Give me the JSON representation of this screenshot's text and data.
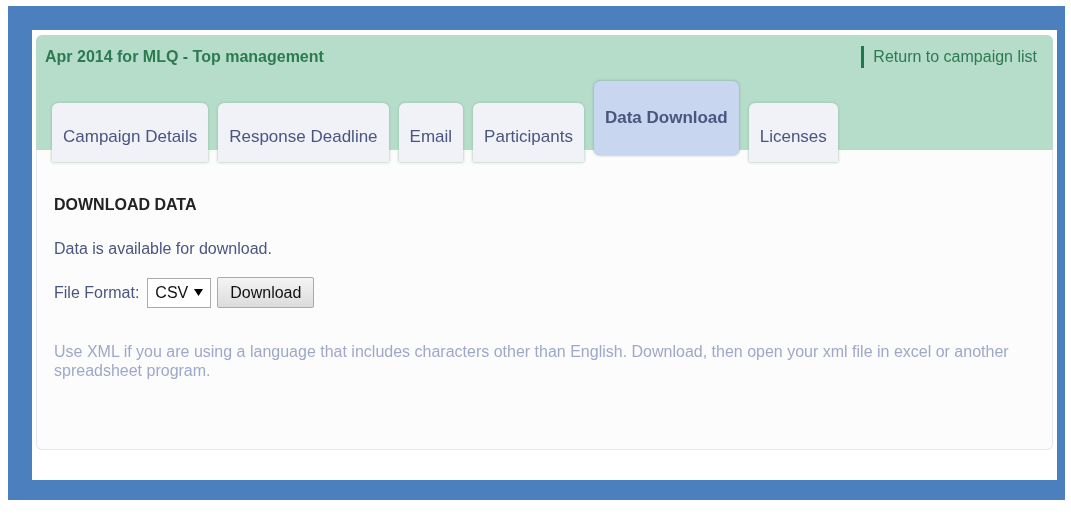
{
  "header": {
    "title": "Apr 2014 for MLQ - Top management",
    "link": "Return to campaign list"
  },
  "tabs": [
    {
      "label": "Campaign Details",
      "selected": false
    },
    {
      "label": "Response Deadline",
      "selected": false
    },
    {
      "label": "Email",
      "selected": false
    },
    {
      "label": "Participants",
      "selected": false
    },
    {
      "label": "Data Download",
      "selected": true
    },
    {
      "label": "Licenses",
      "selected": false
    }
  ],
  "section": {
    "heading": "DOWNLOAD DATA",
    "status": "Data is available for download.",
    "format_label": "File Format:",
    "format_value": "CSV",
    "button": "Download",
    "note": "Use XML if you are using a language that includes characters other than English. Download, then open your xml file in excel or another spreadsheet program."
  }
}
